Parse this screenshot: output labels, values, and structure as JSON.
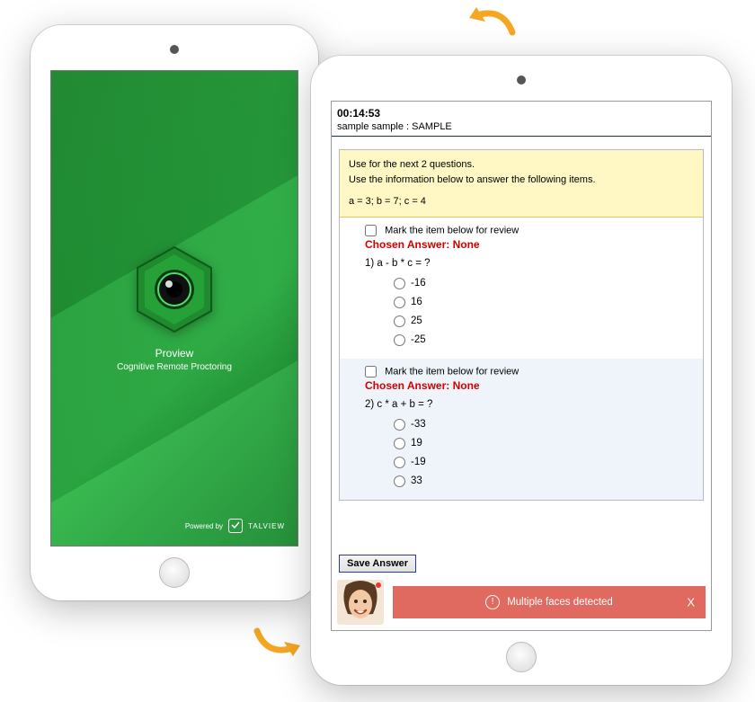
{
  "splash": {
    "title": "Proview",
    "subtitle": "Cognitive Remote Proctoring",
    "powered_label": "Powered by",
    "powered_brand": "TALVIEW"
  },
  "exam": {
    "timer": "00:14:53",
    "candidate": "sample sample : SAMPLE",
    "stimulus_line1": "Use for the next 2 questions.",
    "stimulus_line2": "Use the information below to answer the following items.",
    "stimulus_data": "a = 3; b = 7; c = 4",
    "mark_label": "Mark the item below for review",
    "chosen_prefix": "Chosen Answer:",
    "chosen_value_none": "None",
    "q1": {
      "stem": "1) a - b * c = ?",
      "options": [
        "-16",
        "16",
        "25",
        "-25"
      ]
    },
    "q2": {
      "stem": "2) c * a + b = ?",
      "options": [
        "-33",
        "19",
        "-19",
        "33"
      ]
    },
    "save_label": "Save Answer"
  },
  "alert": {
    "message": "Multiple faces detected",
    "close_glyph": "X"
  }
}
